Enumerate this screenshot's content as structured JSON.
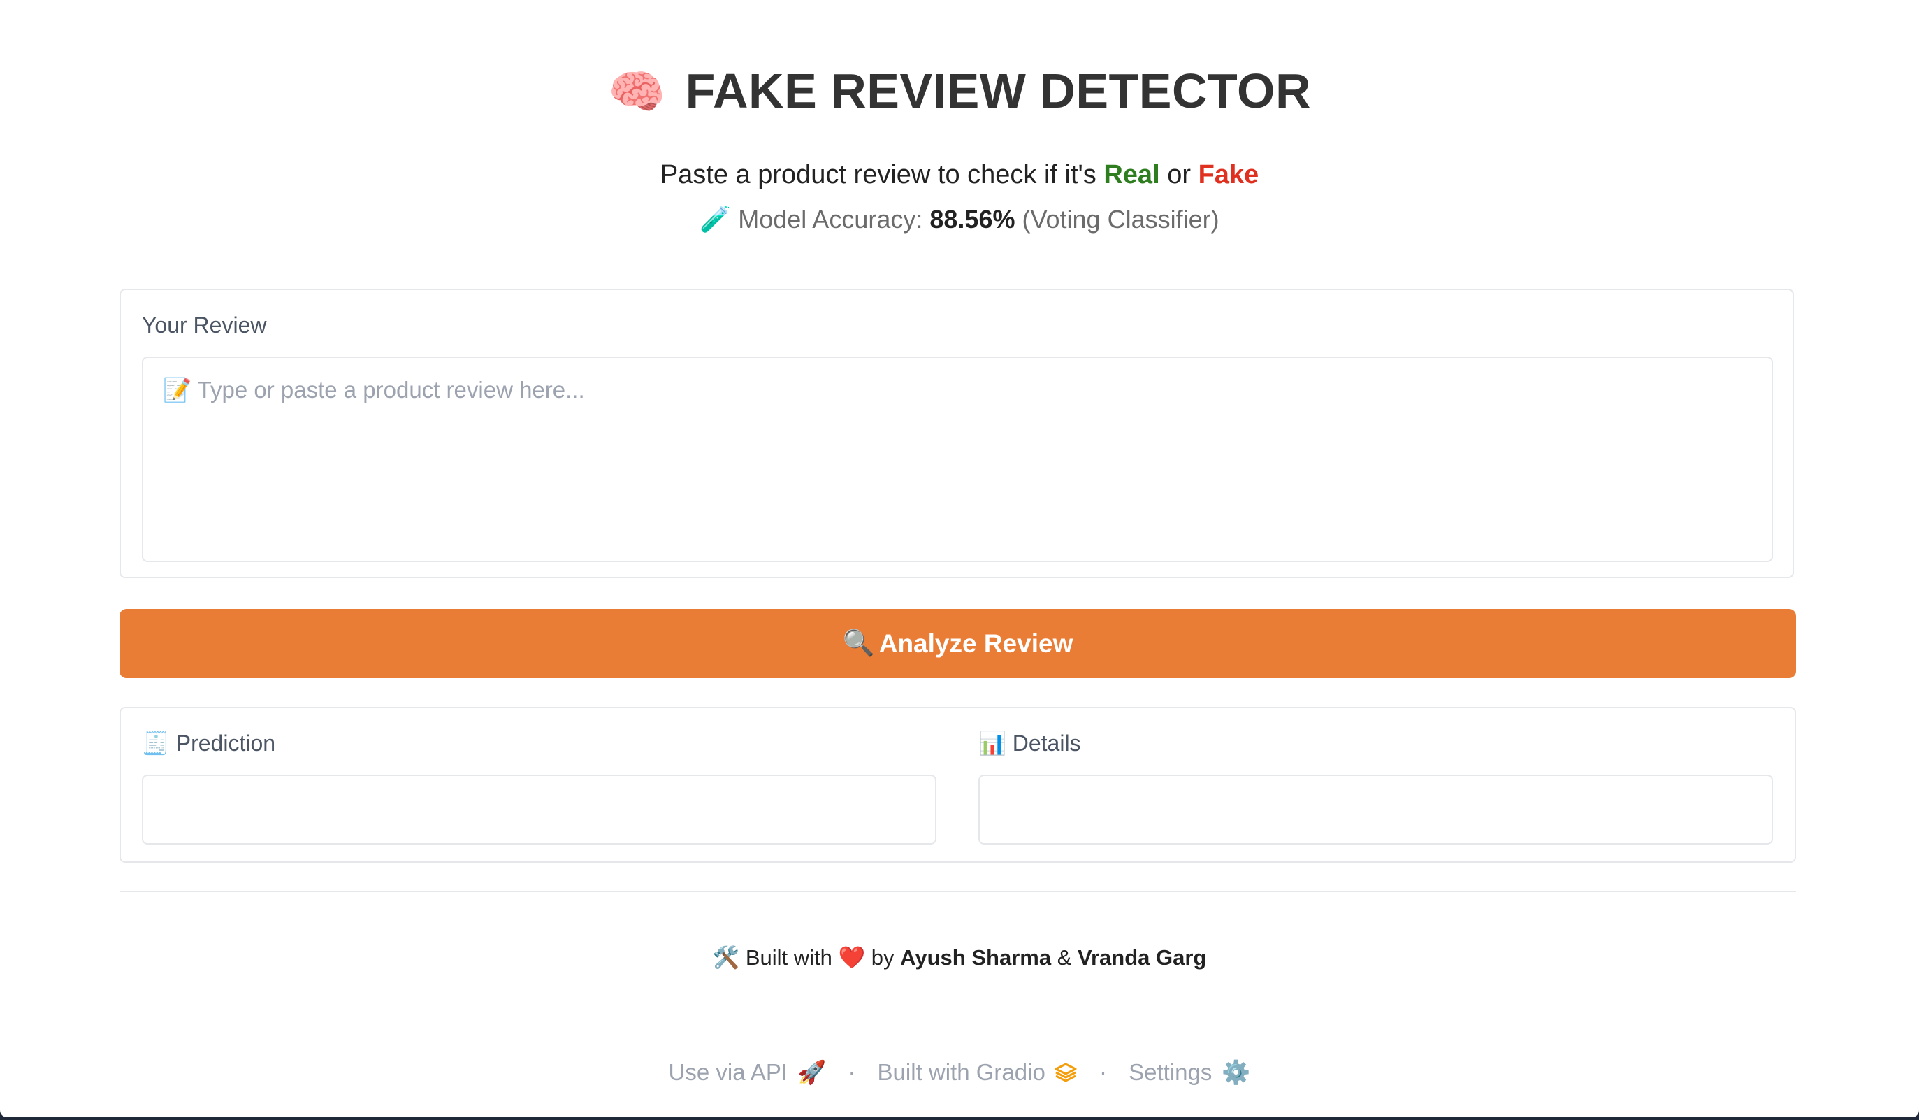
{
  "header": {
    "title_icon": "🧠",
    "title": "FAKE REVIEW DETECTOR",
    "subtitle_prefix": "Paste a product review to check if it's",
    "subtitle_real": "Real",
    "subtitle_or": "or",
    "subtitle_fake": "Fake",
    "accuracy_icon": "🧪",
    "accuracy_label": "Model Accuracy:",
    "accuracy_value": "88.56%",
    "accuracy_model": "(Voting Classifier)"
  },
  "review": {
    "label": "Your Review",
    "placeholder": "📝 Type or paste a product review here...",
    "value": ""
  },
  "analyze_button": {
    "icon": "🔍",
    "label": "Analyze Review"
  },
  "outputs": {
    "prediction_icon": "🧾",
    "prediction_label": "Prediction",
    "prediction_value": "",
    "details_icon": "📊",
    "details_label": "Details",
    "details_value": ""
  },
  "credits": {
    "tools_icon": "🛠️",
    "built_with": "Built with",
    "heart_icon": "❤️",
    "by": "by",
    "author1": "Ayush Sharma",
    "amp": "&",
    "author2": "Vranda Garg"
  },
  "footer": {
    "api_label": "Use via API",
    "api_icon": "🚀",
    "gradio_label": "Built with Gradio",
    "settings_label": "Settings",
    "settings_icon": "⚙️",
    "separator": "·"
  },
  "colors": {
    "accent": "#e97d35",
    "real": "#2e7d1f",
    "fake": "#e03020"
  }
}
